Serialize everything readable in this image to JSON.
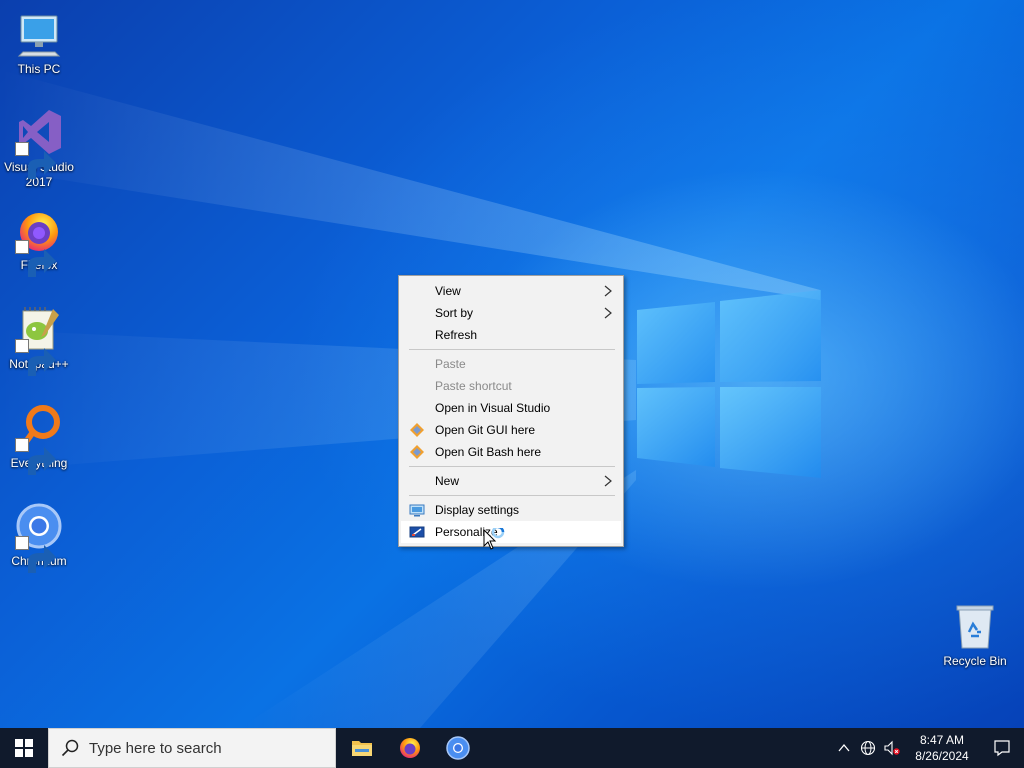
{
  "desktop": {
    "icons": [
      {
        "label": "This PC",
        "icon": "this-pc-icon"
      },
      {
        "label": "Visual Studio 2017",
        "icon": "visual-studio-icon"
      },
      {
        "label": "Firefox",
        "icon": "firefox-icon"
      },
      {
        "label": "Notepad++",
        "icon": "notepadpp-icon"
      },
      {
        "label": "Everything",
        "icon": "everything-icon"
      },
      {
        "label": "Chromium",
        "icon": "chromium-icon"
      },
      {
        "label": "Recycle Bin",
        "icon": "recycle-bin-icon"
      }
    ]
  },
  "context_menu": {
    "items": [
      {
        "label": "View",
        "submenu": true
      },
      {
        "label": "Sort by",
        "submenu": true
      },
      {
        "label": "Refresh"
      },
      {
        "label": "Paste",
        "disabled": true
      },
      {
        "label": "Paste shortcut",
        "disabled": true
      },
      {
        "label": "Open in Visual Studio"
      },
      {
        "label": "Open Git GUI here",
        "icon": "git-gui-icon"
      },
      {
        "label": "Open Git Bash here",
        "icon": "git-bash-icon"
      },
      {
        "label": "New",
        "submenu": true
      },
      {
        "label": "Display settings",
        "icon": "display-settings-icon"
      },
      {
        "label": "Personalize",
        "icon": "personalize-icon",
        "highlighted": true
      }
    ]
  },
  "taskbar": {
    "search_placeholder": "Type here to search",
    "pinned_apps": [
      "file-explorer-icon",
      "firefox-icon",
      "chromium-icon"
    ],
    "clock_time": "8:47 AM",
    "clock_date": "8/26/2024"
  },
  "colors": {
    "taskbar_bg": "#101a2c",
    "menu_bg": "#f2f2f2",
    "accent": "#0078d7"
  }
}
